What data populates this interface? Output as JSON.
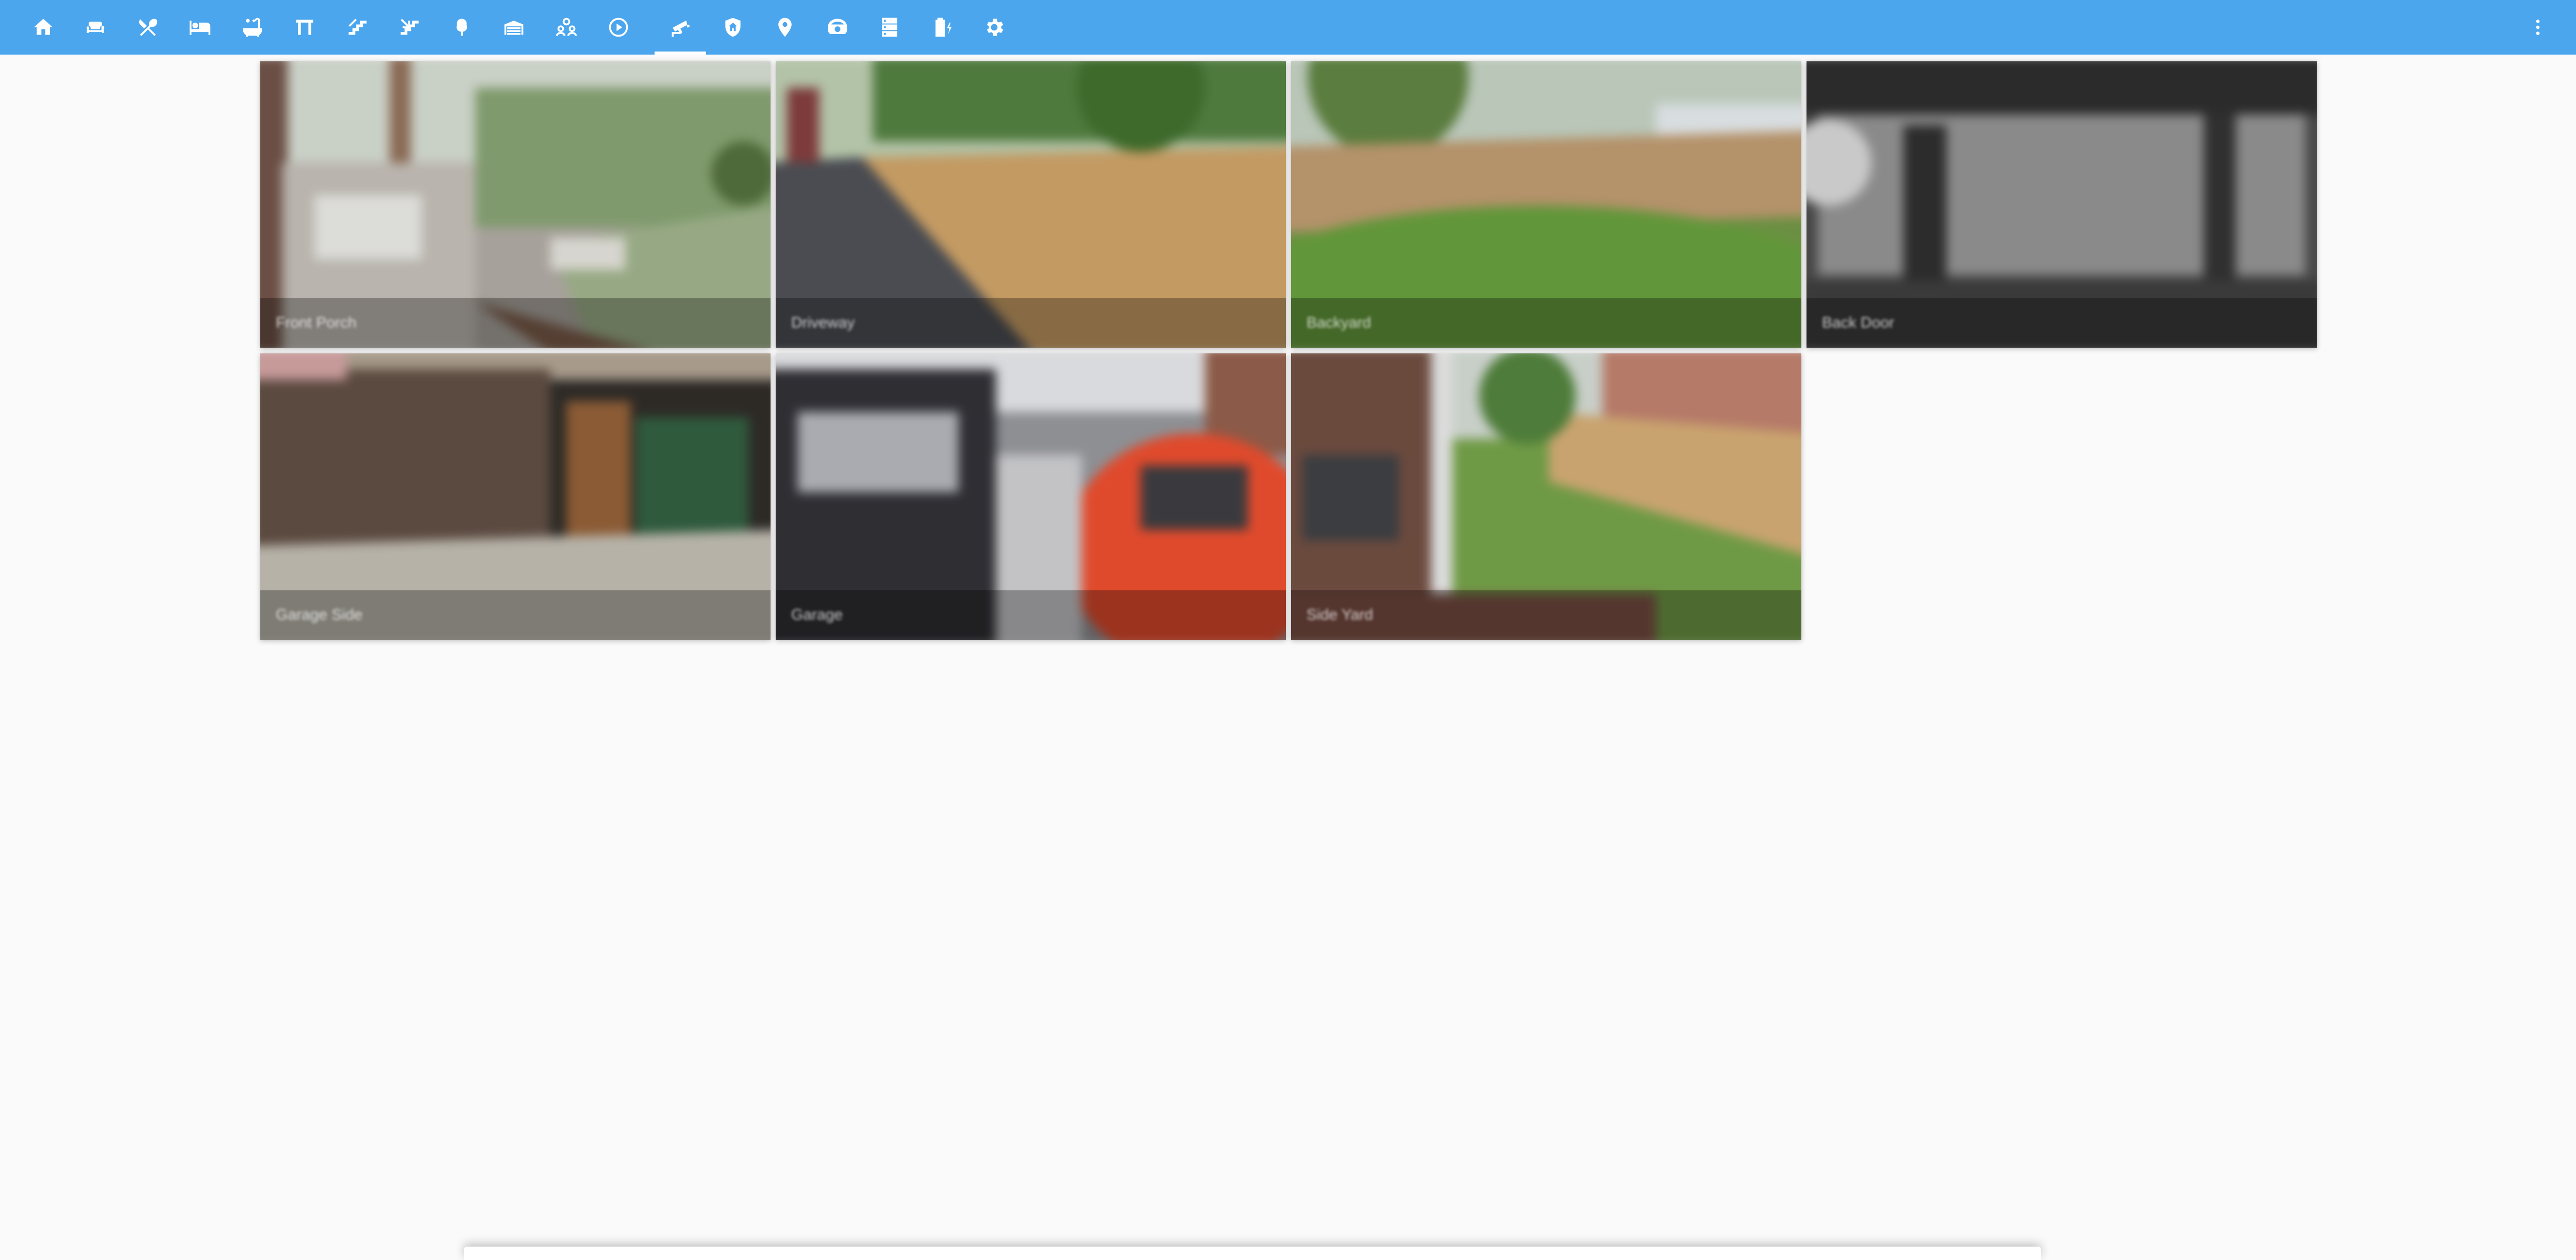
{
  "topbar": {
    "background": "#4ba6ee",
    "tabs": [
      {
        "icon": "home-icon",
        "active": false
      },
      {
        "icon": "sofa-icon",
        "active": false
      },
      {
        "icon": "silverware-icon",
        "active": false
      },
      {
        "icon": "bed-icon",
        "active": false
      },
      {
        "icon": "bathtub-icon",
        "active": false
      },
      {
        "icon": "door-icon",
        "active": false
      },
      {
        "icon": "stairs-up-icon",
        "active": false
      },
      {
        "icon": "stairs-down-icon",
        "active": false
      },
      {
        "icon": "tree-icon",
        "active": false
      },
      {
        "icon": "garage-icon",
        "active": false
      },
      {
        "icon": "family-icon",
        "active": false
      },
      {
        "icon": "play-circle-icon",
        "active": false
      },
      {
        "icon": "cctv-icon",
        "active": true
      },
      {
        "icon": "shield-home-icon",
        "active": false
      },
      {
        "icon": "map-marker-icon",
        "active": false
      },
      {
        "icon": "robot-vacuum-icon",
        "active": false
      },
      {
        "icon": "server-icon",
        "active": false
      },
      {
        "icon": "battery-charging-icon",
        "active": false
      },
      {
        "icon": "settings-icon",
        "active": false
      }
    ],
    "menu_icon": "dots-vertical-icon"
  },
  "cameras": [
    {
      "label": "Front Porch"
    },
    {
      "label": "Driveway"
    },
    {
      "label": "Backyard"
    },
    {
      "label": "Back Door"
    },
    {
      "label": "Garage Side"
    },
    {
      "label": "Garage"
    },
    {
      "label": "Side Yard"
    }
  ]
}
